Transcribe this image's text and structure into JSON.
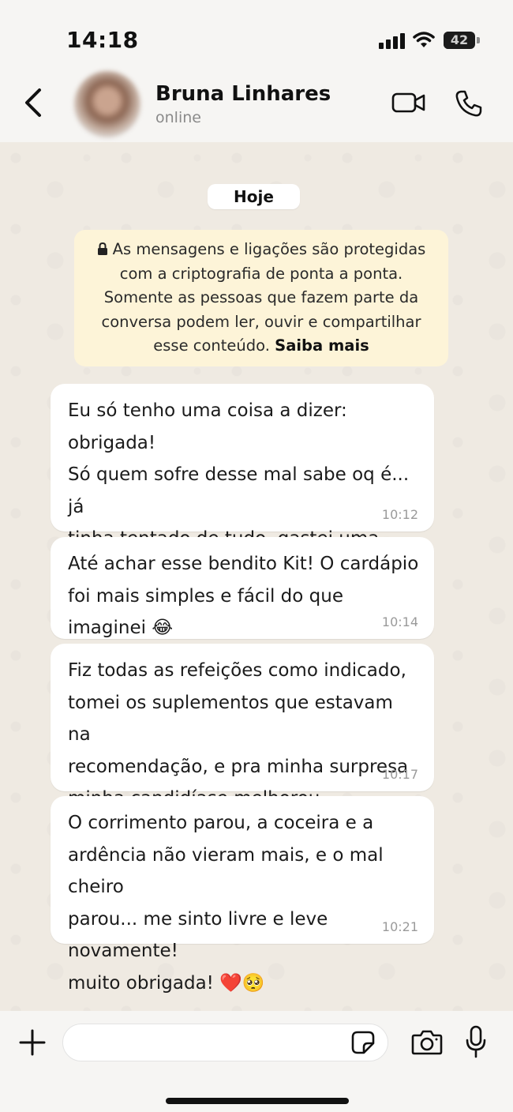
{
  "status_bar": {
    "time": "14:18",
    "battery": "42",
    "battery_level": 0.42
  },
  "header": {
    "contact_name": "Bruna Linhares",
    "contact_status": "online",
    "icons": [
      "back-icon",
      "video-call-icon",
      "phone-call-icon"
    ]
  },
  "chat": {
    "date_label": "Hoje",
    "encryption_notice": {
      "text": "As mensagens e ligações são protegidas com a criptografia de ponta a ponta. Somente as pessoas que fazem parte da conversa podem ler, ouvir e compartilhar esse conteúdo.",
      "link": "Saiba mais"
    },
    "messages": [
      {
        "text": "Eu só tenho uma coisa a dizer: obrigada!\nSó quem sofre desse mal sabe oq é... já\ntinha tentado de tudo, gastei uma fortuna\ne nunca resolvia.",
        "time": "10:12"
      },
      {
        "text": "Até achar esse bendito Kit! O cardápio\nfoi mais simples e fácil do que imaginei 😂",
        "time": "10:14"
      },
      {
        "text": "Fiz todas as refeições como indicado,\ntomei os suplementos que estavam na\nrecomendação, e pra minha surpresa\nminha candidíase melhorou.",
        "time": "10:17"
      },
      {
        "text": "O corrimento parou, a coceira e a\nardência não vieram mais, e o mal cheiro\nparou... me sinto livre e leve novamente!\nmuito obrigada! ❤️🥺",
        "time": "10:21"
      }
    ]
  },
  "input_bar": {
    "message_value": "",
    "icons": [
      "plus-icon",
      "sticker-icon",
      "camera-icon",
      "microphone-icon"
    ]
  }
}
